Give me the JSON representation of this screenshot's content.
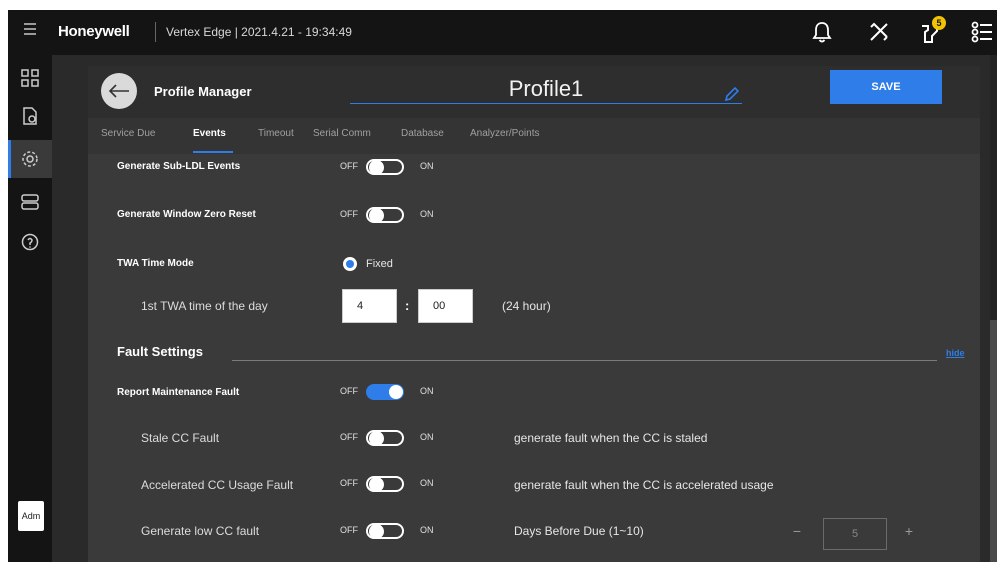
{
  "header": {
    "brand": "Honeywell",
    "app_title": "Vertex Edge | 2021.4.21 - 19:34:49",
    "notification_count": "5",
    "icons": [
      "menu-icon",
      "bell-icon",
      "tools-icon",
      "maintenance-icon",
      "list-icon"
    ]
  },
  "sidebar": {
    "items": [
      {
        "name": "dashboard-icon",
        "active": false
      },
      {
        "name": "report-icon",
        "active": false
      },
      {
        "name": "settings-icon",
        "active": true
      },
      {
        "name": "devices-icon",
        "active": false
      },
      {
        "name": "help-icon",
        "active": false
      }
    ],
    "avatar_label": "Adm"
  },
  "profile": {
    "title": "Profile Manager",
    "name": "Profile1",
    "save_label": "SAVE"
  },
  "tabs": [
    {
      "label": "Service Due",
      "active": false
    },
    {
      "label": "Events",
      "active": true
    },
    {
      "label": "Timeout",
      "active": false
    },
    {
      "label": "Serial Comm",
      "active": false
    },
    {
      "label": "Database",
      "active": false
    },
    {
      "label": "Analyzer/Points",
      "active": false
    }
  ],
  "events": {
    "sub_ldl": {
      "label": "Generate Sub-LDL Events",
      "off": "OFF",
      "on": "ON",
      "state": false
    },
    "window_zero": {
      "label": "Generate Window Zero Reset",
      "off": "OFF",
      "on": "ON",
      "state": false
    },
    "twa_mode": {
      "label": "TWA Time Mode",
      "option": "Fixed",
      "selected": true
    },
    "twa_time": {
      "label": "1st TWA time of the day",
      "hour": "4",
      "minute": "00",
      "unit": "(24 hour)"
    }
  },
  "fault_settings": {
    "title": "Fault Settings",
    "hide_label": "hide",
    "report_maintenance": {
      "label": "Report Maintenance Fault",
      "off": "OFF",
      "on": "ON",
      "state": true
    },
    "stale_cc": {
      "label": "Stale CC Fault",
      "off": "OFF",
      "on": "ON",
      "state": false,
      "hint": "generate fault when the CC is staled"
    },
    "accelerated_cc": {
      "label": "Accelerated CC Usage Fault",
      "off": "OFF",
      "on": "ON",
      "state": false,
      "hint": "generate fault when the CC is accelerated usage"
    },
    "low_cc": {
      "label": "Generate low CC fault",
      "off": "OFF",
      "on": "ON",
      "state": false,
      "days_label": "Days Before Due (1~10)",
      "days_value": "5",
      "minus": "−",
      "plus": "+"
    }
  },
  "colors": {
    "accent": "#2e7de8",
    "header_bg": "#141414",
    "content_bg": "#3a3a3a",
    "badge": "#f2c300"
  }
}
